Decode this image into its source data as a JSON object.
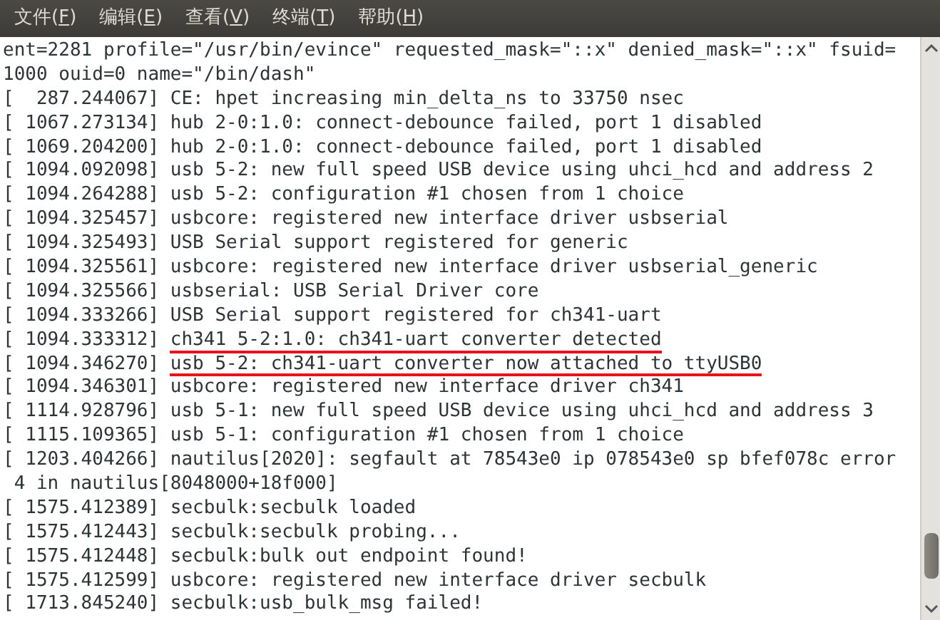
{
  "menu": [
    {
      "before": "文件(",
      "key": "F",
      "after": ")"
    },
    {
      "before": "编辑(",
      "key": "E",
      "after": ")"
    },
    {
      "before": "查看(",
      "key": "V",
      "after": ")"
    },
    {
      "before": "终端(",
      "key": "T",
      "after": ")"
    },
    {
      "before": "帮助(",
      "key": "H",
      "after": ")"
    }
  ],
  "terminal": {
    "lines": [
      {
        "text": "ent=2281 profile=\"/usr/bin/evince\" requested_mask=\"::x\" denied_mask=\"::x\" fsuid=",
        "underlined": false
      },
      {
        "text": "1000 ouid=0 name=\"/bin/dash\"",
        "underlined": false
      },
      {
        "text": "[  287.244067] CE: hpet increasing min_delta_ns to 33750 nsec",
        "underlined": false
      },
      {
        "text": "[ 1067.273134] hub 2-0:1.0: connect-debounce failed, port 1 disabled",
        "underlined": false
      },
      {
        "text": "[ 1069.204200] hub 2-0:1.0: connect-debounce failed, port 1 disabled",
        "underlined": false
      },
      {
        "text": "[ 1094.092098] usb 5-2: new full speed USB device using uhci_hcd and address 2",
        "underlined": false
      },
      {
        "text": "[ 1094.264288] usb 5-2: configuration #1 chosen from 1 choice",
        "underlined": false
      },
      {
        "text": "[ 1094.325457] usbcore: registered new interface driver usbserial",
        "underlined": false
      },
      {
        "text": "[ 1094.325493] USB Serial support registered for generic",
        "underlined": false
      },
      {
        "text": "[ 1094.325561] usbcore: registered new interface driver usbserial_generic",
        "underlined": false
      },
      {
        "text": "[ 1094.325566] usbserial: USB Serial Driver core",
        "underlined": false
      },
      {
        "text": "[ 1094.333266] USB Serial support registered for ch341-uart",
        "underlined": false
      },
      {
        "text": "[ 1094.333312] ch341 5-2:1.0: ch341-uart converter detected",
        "underlined": true
      },
      {
        "text": "[ 1094.346270] usb 5-2: ch341-uart converter now attached to ttyUSB0",
        "underlined": true
      },
      {
        "text": "[ 1094.346301] usbcore: registered new interface driver ch341",
        "underlined": false
      },
      {
        "text": "[ 1114.928796] usb 5-1: new full speed USB device using uhci_hcd and address 3",
        "underlined": false
      },
      {
        "text": "[ 1115.109365] usb 5-1: configuration #1 chosen from 1 choice",
        "underlined": false
      },
      {
        "text": "[ 1203.404266] nautilus[2020]: segfault at 78543e0 ip 078543e0 sp bfef078c error",
        "underlined": false
      },
      {
        "text": " 4 in nautilus[8048000+18f000]",
        "underlined": false
      },
      {
        "text": "[ 1575.412389] secbulk:secbulk loaded",
        "underlined": false
      },
      {
        "text": "[ 1575.412443] secbulk:secbulk probing...",
        "underlined": false
      },
      {
        "text": "[ 1575.412448] secbulk:bulk out endpoint found!",
        "underlined": false
      },
      {
        "text": "[ 1575.412599] usbcore: registered new interface driver secbulk",
        "underlined": false
      },
      {
        "text": "[ 1713.845240] secbulk:usb_bulk_msg failed!",
        "underlined": false
      }
    ]
  }
}
